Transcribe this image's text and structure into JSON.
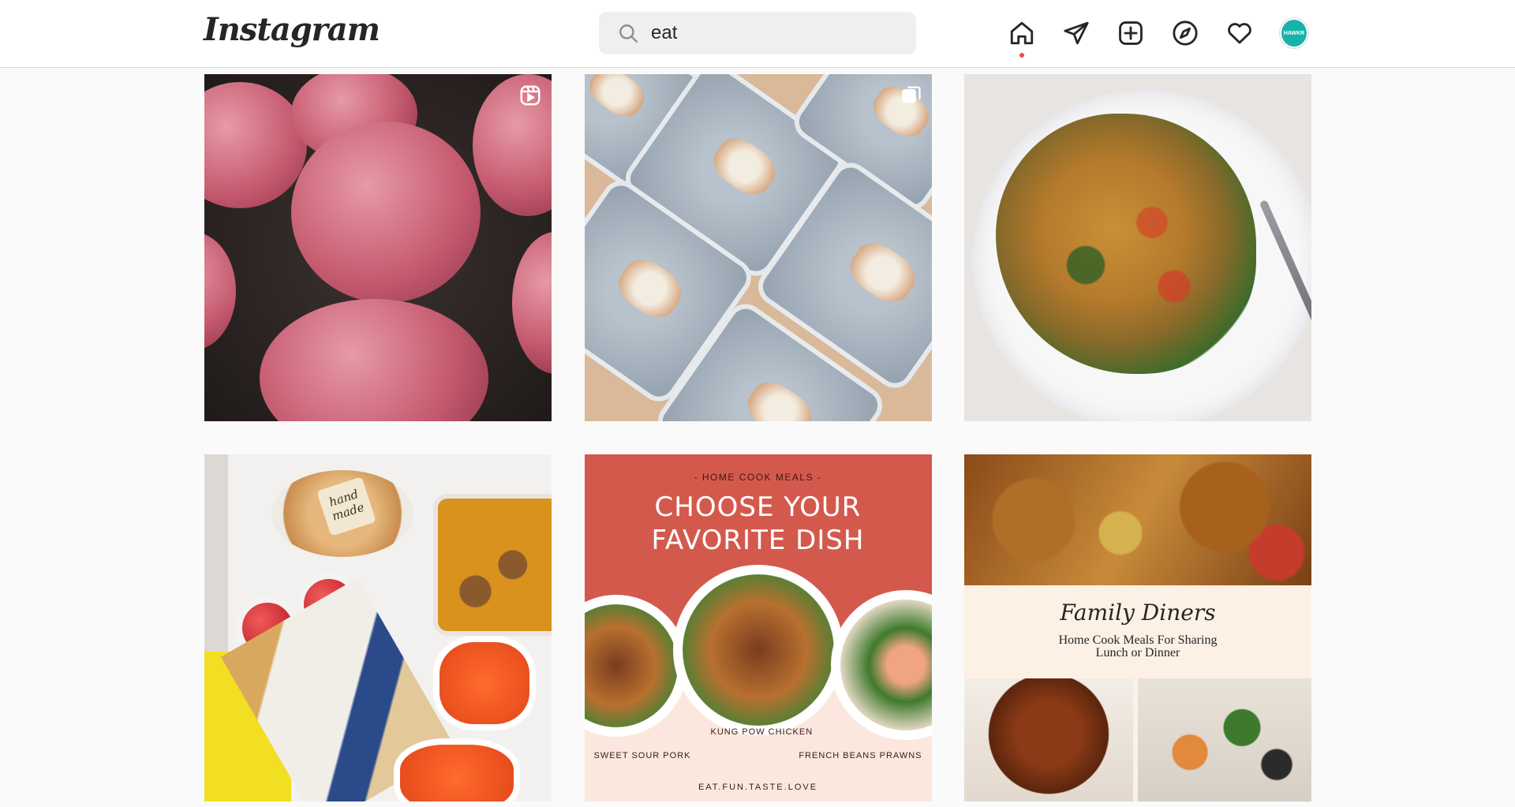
{
  "app": {
    "logo": "Instagram"
  },
  "search": {
    "value": "eat",
    "placeholder": "Search"
  },
  "nav": {
    "items": [
      {
        "name": "home",
        "icon": "home-icon",
        "active": true
      },
      {
        "name": "messages",
        "icon": "paper-plane-icon"
      },
      {
        "name": "new-post",
        "icon": "plus-square-icon"
      },
      {
        "name": "explore",
        "icon": "compass-icon"
      },
      {
        "name": "activity",
        "icon": "heart-icon"
      },
      {
        "name": "profile",
        "icon": "avatar"
      }
    ],
    "avatar_text": "HAWKR"
  },
  "colors": {
    "accent_dot": "#ed4956",
    "avatar_bg": "#17b3a8",
    "poster_red": "#d4594d",
    "poster_cream": "#fbe7de"
  },
  "posts": {
    "p1": {
      "badge": "reels-icon"
    },
    "p2": {
      "badge": "carousel-icon"
    },
    "p4": {
      "sticker_line1": "hand",
      "sticker_line2": "made"
    },
    "p5": {
      "kicker": "- HOME COOK MEALS -",
      "headline_line1": "CHOOSE YOUR",
      "headline_line2": "FAVORITE DISH",
      "center_label": "KUNG POW CHICKEN",
      "left_label": "SWEET SOUR PORK",
      "right_label": "FRENCH BEANS PRAWNS",
      "footer": "EAT.FUN.TASTE.LOVE"
    },
    "p6": {
      "title": "Family Diners",
      "subtitle_line1": "Home Cook Meals For Sharing",
      "subtitle_line2": "Lunch or Dinner"
    }
  }
}
